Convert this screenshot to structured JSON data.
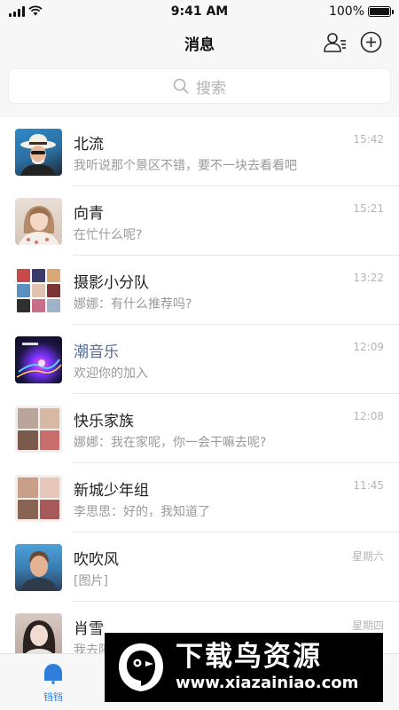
{
  "status_bar": {
    "time": "9:41 AM",
    "battery": "100%"
  },
  "nav": {
    "title": "消息",
    "icons": [
      "contacts-icon",
      "add-circle-icon"
    ]
  },
  "search": {
    "placeholder": "搜索"
  },
  "chats": [
    {
      "name": "北流",
      "preview": "我听说那个景区不错，要不一块去看看吧",
      "time": "15:42",
      "avatar": "portrait-hat-man"
    },
    {
      "name": "向青",
      "preview": "在忙什么呢?",
      "time": "15:21",
      "avatar": "portrait-girl"
    },
    {
      "name": "摄影小分队",
      "preview": "娜娜：有什么推荐吗?",
      "time": "13:22",
      "avatar": "group-grid-9"
    },
    {
      "name": "潮音乐",
      "preview": "欢迎你的加入",
      "time": "12:09",
      "avatar": "music-cover"
    },
    {
      "name": "快乐家族",
      "preview": "娜娜：我在家呢，你一会干嘛去呢?",
      "time": "12:08",
      "avatar": "group-grid-4"
    },
    {
      "name": "新城少年组",
      "preview": "李思思：好的，我知道了",
      "time": "11:45",
      "avatar": "group-grid-4"
    },
    {
      "name": "吹吹风",
      "preview": "[图片]",
      "time": "星期六",
      "avatar": "portrait-man"
    },
    {
      "name": "肖雪",
      "preview": "我去阳",
      "time": "星期四",
      "avatar": "portrait-woman"
    }
  ],
  "tab_bar": {
    "active_label": "铛铛"
  },
  "watermark": {
    "title": "下载鸟资源",
    "url": "www.xiazainiao.com"
  },
  "colors": {
    "accent": "#2d7fdb",
    "official_name": "#576b95",
    "bar_background": "#f7f7f7"
  }
}
